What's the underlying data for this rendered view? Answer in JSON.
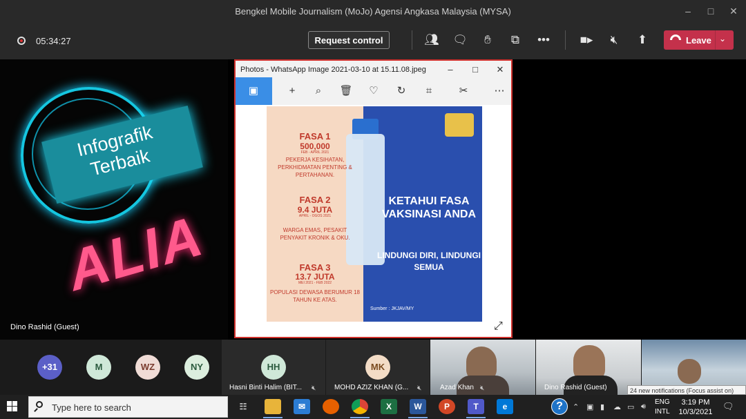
{
  "window": {
    "title": "Bengkel Mobile Journalism (MoJo) Agensi Angkasa Malaysia (MYSA)"
  },
  "meeting": {
    "timer": "05:34:27",
    "request_control": "Request control",
    "leave_label": "Leave"
  },
  "stage": {
    "banner_text": "Infografik Terbaik",
    "name_text": "ALIA",
    "presenter_label": "Dino Rashid (Guest)"
  },
  "photos": {
    "title": "Photos - WhatsApp Image 2021-03-10 at 15.11.08.jpeg",
    "infographic": {
      "fasa1": "FASA 1",
      "fasa1_num": "500,000",
      "fasa1_date": "FEB - APRIL 2021",
      "fasa1_desc": "PEKERJA KESIHATAN, PERKHIDMATAN PENTING & PERTAHANAN.",
      "fasa2": "FASA 2",
      "fasa2_num": "9.4 JUTA",
      "fasa2_date": "APRIL - OGOS 2021",
      "fasa2_desc": "WARGA EMAS, PESAKIT PENYAKIT KRONIK & OKU.",
      "fasa3": "FASA 3",
      "fasa3_num": "13.7 JUTA",
      "fasa3_date": "MEI 2021 - FEB 2022",
      "fasa3_desc": "POPULASI DEWASA BERUMUR 18 TAHUN KE ATAS.",
      "heading": "KETAHUI FASA VAKSINASI ANDA",
      "subheading": "LINDUNGI DIRI, LINDUNGI SEMUA",
      "source": "Sumber : JKJAV/MY"
    }
  },
  "participants": {
    "overflow": "+31",
    "avatars": [
      "M",
      "WZ",
      "NY"
    ],
    "tiles": [
      {
        "initials": "HH",
        "name": "Hasni Binti Halim (BIT..."
      },
      {
        "initials": "MK",
        "name": "MOHD AZIZ KHAN (G..."
      }
    ],
    "videos": [
      {
        "name": "Azad Khan"
      },
      {
        "name": "Dino Rashid (Guest)"
      }
    ]
  },
  "notification": "24 new notifications (Focus assist on)",
  "taskbar": {
    "search_placeholder": "Type here to search",
    "lang1": "ENG",
    "lang2": "INTL",
    "time": "3:19 PM",
    "date": "10/3/2021"
  },
  "colors": {
    "leave": "#c4314b",
    "accent": "#3a8ee6",
    "record": "#d33"
  }
}
